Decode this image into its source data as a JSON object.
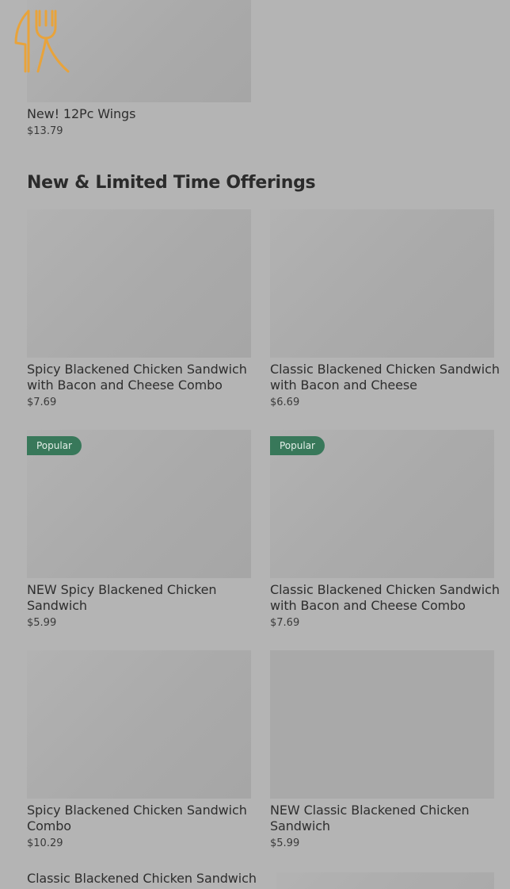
{
  "logo": {
    "icon": "fork-knife-icon",
    "color": "#e8a33b"
  },
  "featured": {
    "name": "New! 12Pc Wings",
    "price": "$13.79"
  },
  "section": {
    "title": "New & Limited Time Offerings"
  },
  "items": [
    {
      "name_line1": "Spicy Blackened Chicken Sandwich",
      "name_line2": "with Bacon and Cheese Combo",
      "price": "$7.69",
      "badge": ""
    },
    {
      "name_line1": "Classic Blackened Chicken Sandwich",
      "name_line2": "with Bacon and Cheese",
      "price": "$6.69",
      "badge": ""
    },
    {
      "name_line1": "NEW Spicy Blackened Chicken",
      "name_line2": "Sandwich",
      "price": "$5.99",
      "badge": "Popular"
    },
    {
      "name_line1": "Classic Blackened Chicken Sandwich",
      "name_line2": "with Bacon and Cheese Combo",
      "price": "$7.69",
      "badge": "Popular"
    },
    {
      "name_line1": "Spicy Blackened Chicken Sandwich",
      "name_line2": "Combo",
      "price": "$10.29",
      "badge": ""
    },
    {
      "name_line1": "NEW Classic Blackened Chicken",
      "name_line2": "Sandwich",
      "price": "$5.99",
      "badge": ""
    },
    {
      "name_line1": "Classic Blackened Chicken Sandwich",
      "name_line2": "",
      "price": "",
      "badge": ""
    }
  ],
  "colors": {
    "badge_bg": "#38785a",
    "overlay": "#b4b4b4"
  }
}
